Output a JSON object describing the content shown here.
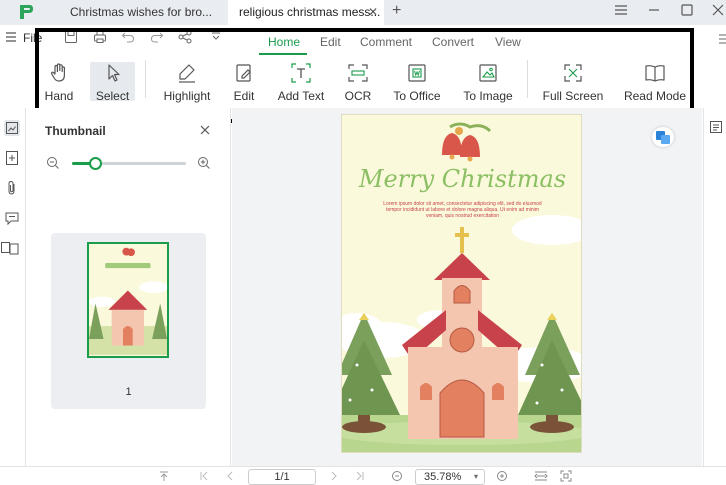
{
  "window": {
    "tabs": [
      {
        "label": "Christmas wishes for bro...",
        "active": false
      },
      {
        "label": "religious christmas mess...",
        "active": true
      }
    ],
    "new_tab_label": "+"
  },
  "menubar": {
    "file_label": "File",
    "tabs": [
      "Home",
      "Edit",
      "Comment",
      "Convert",
      "View"
    ],
    "active_tab": "Home"
  },
  "toolbar": {
    "tools": [
      {
        "label": "Hand",
        "icon": "hand-icon"
      },
      {
        "label": "Select",
        "icon": "cursor-icon",
        "selected": true
      },
      {
        "label": "Highlight",
        "icon": "highlighter-icon"
      },
      {
        "label": "Edit",
        "icon": "edit-icon"
      },
      {
        "label": "Add Text",
        "icon": "add-text-icon"
      },
      {
        "label": "OCR",
        "icon": "ocr-icon"
      },
      {
        "label": "To Office",
        "icon": "to-office-icon"
      },
      {
        "label": "To Image",
        "icon": "to-image-icon"
      },
      {
        "label": "Full Screen",
        "icon": "full-screen-icon"
      },
      {
        "label": "Read Mode",
        "icon": "book-icon"
      }
    ]
  },
  "thumbnail_panel": {
    "title": "Thumbnail",
    "zoom_fraction": 0.2,
    "page_label": "1"
  },
  "document": {
    "heading": "Merry Christmas",
    "body": "Lorem ipsum dolor sit amet, consectetur adipiscing elit, sed do eiusmod tempor incididunt ut labore et dolore magna aliqua. Ut enim ad minim veniam, quis nostrud exercitation"
  },
  "statusbar": {
    "page_indicator": "1/1",
    "zoom_level": "35.78%"
  },
  "colors": {
    "accent": "#1a9d4a",
    "page_bg": "#fbf9dc",
    "title_green": "#8bbf63"
  }
}
